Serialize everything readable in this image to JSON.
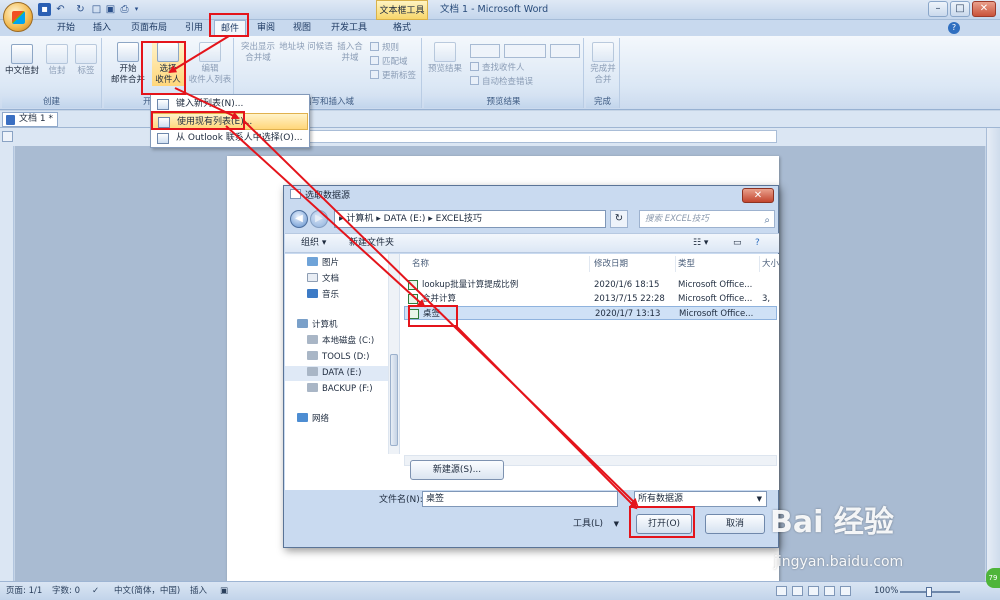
{
  "window": {
    "title": "文档 1 - Microsoft Word",
    "context_tab": "文本框工具",
    "controls": {
      "minimize": "–",
      "maximize": "□",
      "close": "✕"
    }
  },
  "ribbon": {
    "tabs": [
      "开始",
      "插入",
      "页面布局",
      "引用",
      "邮件",
      "审阅",
      "视图",
      "开发工具",
      "格式"
    ],
    "active_tab": "邮件",
    "groups": {
      "create": {
        "label": "创建",
        "buttons": [
          "中文信封",
          "信封",
          "标签"
        ]
      },
      "start_merge": {
        "label": "开始邮件合并",
        "start_label_1": "开始",
        "start_label_2": "邮件合并",
        "select_label_1": "选择",
        "select_label_2": "收件人",
        "edit_label_1": "编辑",
        "edit_label_2": "收件人列表"
      },
      "write_insert": {
        "label": "编写和插入域",
        "buttons": [
          "突出显示合并域",
          "地址块",
          "问候语",
          "插入合并域"
        ],
        "small": [
          "规则",
          "匹配域",
          "更新标签"
        ]
      },
      "preview": {
        "label": "预览结果",
        "preview_button": "预览结果",
        "small": [
          "查找收件人",
          "自动检查错误"
        ]
      },
      "finish": {
        "label": "完成",
        "button_1": "完成并",
        "button_2": "合并"
      }
    }
  },
  "dropdown": {
    "items": [
      "键入新列表(N)...",
      "使用现有列表(E)...",
      "从 Outlook 联系人中选择(O)..."
    ],
    "highlighted_index": 1
  },
  "document": {
    "tab_label": "文档 1 *"
  },
  "dialog": {
    "title": "选取数据源",
    "address_path": "▸ 计算机 ▸ DATA (E:) ▸ EXCEL技巧",
    "search_placeholder": "搜索 EXCEL技巧",
    "toolbar": {
      "organize": "组织 ▾",
      "new_folder": "新建文件夹"
    },
    "nav_items": [
      {
        "label": "图片",
        "icon": "picture-icon"
      },
      {
        "label": "文档",
        "icon": "document-icon"
      },
      {
        "label": "音乐",
        "icon": "music-icon"
      },
      {
        "label": "计算机",
        "icon": "computer-icon"
      },
      {
        "label": "本地磁盘 (C:)",
        "icon": "drive-icon"
      },
      {
        "label": "TOOLS (D:)",
        "icon": "drive-icon"
      },
      {
        "label": "DATA (E:)",
        "icon": "drive-icon"
      },
      {
        "label": "BACKUP (F:)",
        "icon": "drive-icon"
      },
      {
        "label": "网络",
        "icon": "network-icon"
      }
    ],
    "selected_nav_index": 6,
    "columns": [
      "名称",
      "修改日期",
      "类型",
      "大小"
    ],
    "files": [
      {
        "name": "lookup批量计算提成比例",
        "date": "2020/1/6 18:15",
        "type": "Microsoft Office...",
        "size": ""
      },
      {
        "name": "合并计算",
        "date": "2013/7/15 22:28",
        "type": "Microsoft Office...",
        "size": "3,"
      },
      {
        "name": "桌签",
        "date": "2020/1/7 13:13",
        "type": "Microsoft Office...",
        "size": ""
      }
    ],
    "selected_file_index": 2,
    "new_source_button": "新建源(S)...",
    "filename_label": "文件名(N):",
    "filename_value": "桌签",
    "filetype_value": "所有数据源",
    "tools_label": "工具(L)",
    "open_button": "打开(O)",
    "cancel_button": "取消"
  },
  "statusbar": {
    "page": "页面: 1/1",
    "words": "字数: 0",
    "language": "中文(简体，中国)",
    "mode": "插入",
    "zoom": "100%"
  },
  "watermark": {
    "main": "Bai 经验",
    "sub": "jingyan.baidu.com",
    "badge": "79"
  },
  "colors": {
    "annotation_red": "#e4141b",
    "ribbon_blue": "#c8d9ee",
    "highlight_gold": "#ffd67a"
  }
}
